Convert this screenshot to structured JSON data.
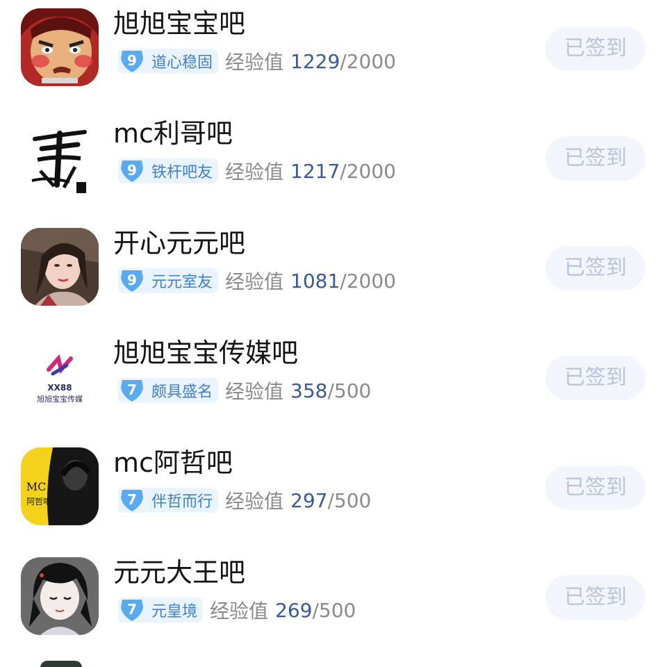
{
  "colors": {
    "badge_bg": "#eaf4fe",
    "badge_shield": "#5aaaf0",
    "badge_text": "#3f7fd0",
    "exp_current": "#3a5a96",
    "exp_gray": "#8a8a8a",
    "signed_bg": "#f2f5fc",
    "signed_text": "#b8c4dc"
  },
  "forums": [
    {
      "name": "旭旭宝宝吧",
      "level": "9",
      "title": "道心稳固",
      "exp_label": "经验值",
      "exp_current": "1229",
      "exp_max": "/2000",
      "status": "已签到",
      "avatar": "cartoon-face-avatar"
    },
    {
      "name": "mc利哥吧",
      "level": "9",
      "title": "铁杆吧友",
      "exp_label": "经验值",
      "exp_current": "1217",
      "exp_max": "/2000",
      "status": "已签到",
      "avatar": "calligraphy-avatar"
    },
    {
      "name": "开心元元吧",
      "level": "9",
      "title": "元元室友",
      "exp_label": "经验值",
      "exp_current": "1081",
      "exp_max": "/2000",
      "status": "已签到",
      "avatar": "portrait-avatar"
    },
    {
      "name": "旭旭宝宝传媒吧",
      "level": "7",
      "title": "颇具盛名",
      "exp_label": "经验值",
      "exp_current": "358",
      "exp_max": "/500",
      "status": "已签到",
      "avatar": "logo-avatar",
      "avatar_text": "XX88",
      "avatar_subtext": "旭旭宝宝传媒"
    },
    {
      "name": "mc阿哲吧",
      "level": "7",
      "title": "伴哲而行",
      "exp_label": "经验值",
      "exp_current": "297",
      "exp_max": "/500",
      "status": "已签到",
      "avatar": "poster-avatar",
      "avatar_text": "MC",
      "avatar_subtext": "阿哲吧"
    },
    {
      "name": "元元大王吧",
      "level": "7",
      "title": "元皇境",
      "exp_label": "经验值",
      "exp_current": "269",
      "exp_max": "/500",
      "status": "已签到",
      "avatar": "anime-avatar"
    }
  ]
}
